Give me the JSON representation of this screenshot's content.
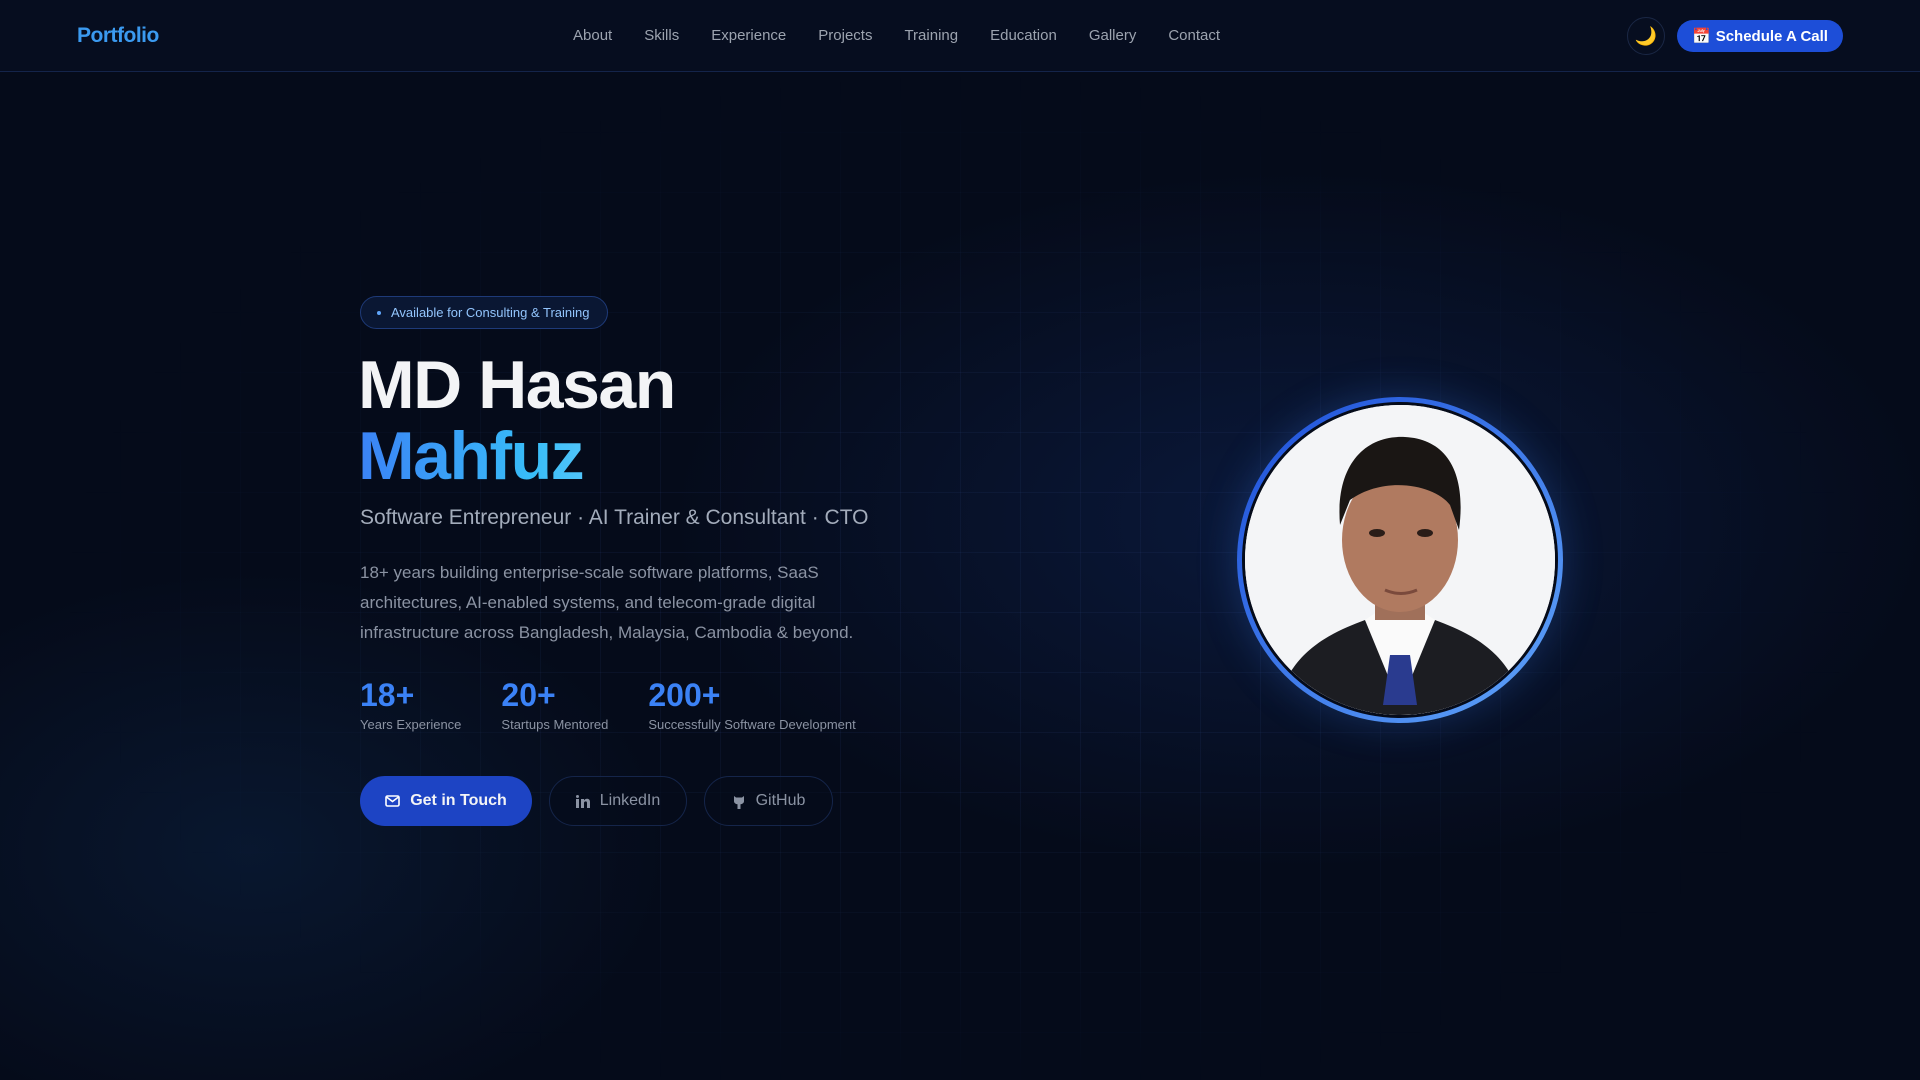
{
  "nav": {
    "logo": "Portfolio",
    "links": [
      "About",
      "Skills",
      "Experience",
      "Projects",
      "Training",
      "Education",
      "Gallery",
      "Contact"
    ],
    "theme_icon": "🌙",
    "schedule_icon": "📅",
    "schedule_label": "Schedule A Call"
  },
  "hero": {
    "badge": "Available for Consulting & Training",
    "name_line1": "MD Hasan",
    "name_line2": "Mahfuz",
    "role": "Software Entrepreneur · AI Trainer & Consultant · CTO",
    "description": "18+ years building enterprise-scale software platforms, SaaS architectures, AI-enabled systems, and telecom-grade digital infrastructure across Bangladesh, Malaysia, Cambodia & beyond.",
    "stats": [
      {
        "value": "18+",
        "label": "Years Experience"
      },
      {
        "value": "20+",
        "label": "Startups Mentored"
      },
      {
        "value": "200+",
        "label": "Successfully Software Development"
      }
    ],
    "buttons": {
      "contact": "Get in Touch",
      "linkedin": "LinkedIn",
      "github": "GitHub"
    }
  },
  "colors": {
    "accent": "#1d4ed8",
    "background": "#050b1a",
    "highlight": "#3b82f6"
  }
}
